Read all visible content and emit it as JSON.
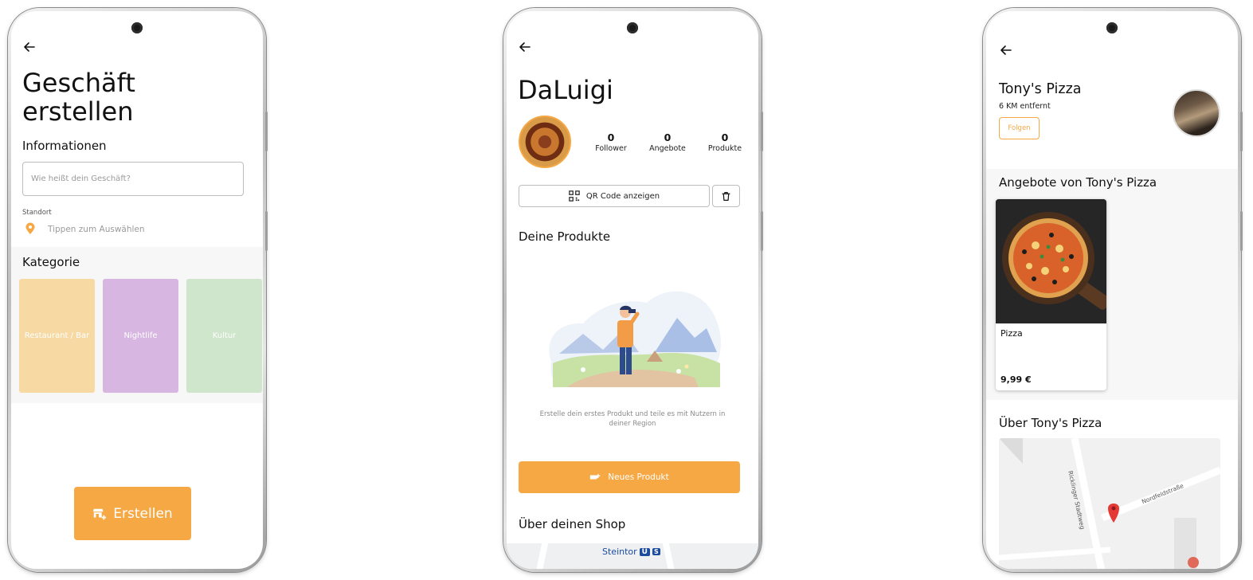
{
  "screen1": {
    "title_line1": "Geschäft",
    "title_line2": "erstellen",
    "info_heading": "Informationen",
    "name_placeholder": "Wie heißt dein Geschäft?",
    "location_label": "Standort",
    "location_hint": "Tippen zum Auswählen",
    "category_heading": "Kategorie",
    "categories": [
      {
        "label": "Restaurant / Bar",
        "color": "#f6d9a3"
      },
      {
        "label": "Nightlife",
        "color": "#d8b6e2"
      },
      {
        "label": "Kultur",
        "color": "#cfe6cc"
      }
    ],
    "create_button": "Erstellen",
    "accent_color": "#f5a843"
  },
  "screen2": {
    "shop_name": "DaLuigi",
    "stats": [
      {
        "value": "0",
        "label": "Follower"
      },
      {
        "value": "0",
        "label": "Angebote"
      },
      {
        "value": "0",
        "label": "Produkte"
      }
    ],
    "qr_button": "QR Code anzeigen",
    "products_heading": "Deine Produkte",
    "empty_text": "Erstelle dein erstes Produkt und teile es mit Nutzern in deiner Region",
    "new_product_button": "Neues Produkt",
    "about_heading": "Über deinen Shop",
    "map_label": "Steintor",
    "map_badges": [
      "U",
      "S"
    ]
  },
  "screen3": {
    "shop_name": "Tony's Pizza",
    "distance": "6 KM entfernt",
    "follow_button": "Folgen",
    "offers_heading": "Angebote von Tony's Pizza",
    "offer": {
      "name": "Pizza",
      "price": "9,99 €"
    },
    "about_heading": "Über Tony's Pizza",
    "map_streets": [
      "Ricklinger Stadtweg",
      "Nordfeldstraße"
    ]
  }
}
